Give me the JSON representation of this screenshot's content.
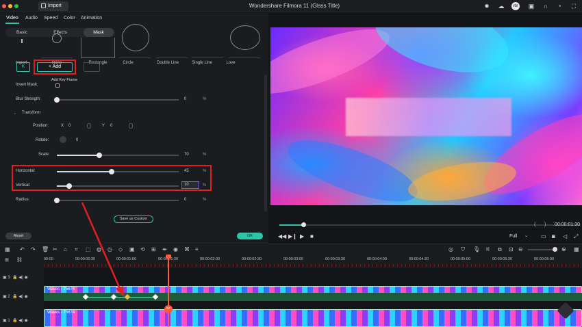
{
  "titlebar": {
    "import_label": "Import",
    "app_title": "Wondershare Filmora 11 (Glass Title)"
  },
  "panel": {
    "tabs": [
      "Video",
      "Audio",
      "Speed",
      "Color",
      "Animation"
    ],
    "subtabs": [
      "Basic",
      "Effects",
      "Mask"
    ],
    "shapes": [
      "Import",
      "None",
      "Rectangle",
      "Circle",
      "Double Line",
      "Single Line",
      "Love"
    ],
    "add_label": "Add",
    "add_tooltip": "Add Key Frame",
    "keyframe_prev": "K",
    "invert_mask": "Invert Mask:",
    "blur_strength": {
      "label": "Blur Strength:",
      "value": "0",
      "unit": "%",
      "fraction": 0.0
    },
    "transform": "Transform",
    "position": {
      "label": "Position:",
      "x_label": "X",
      "x": "0",
      "y_label": "Y",
      "y": "0"
    },
    "rotate": {
      "label": "Rotate:",
      "value": "0"
    },
    "scale": {
      "label": "Scale:",
      "value": "70",
      "unit": "%",
      "fraction": 0.35
    },
    "horizontal": {
      "label": "Horizontal:",
      "value": "45",
      "unit": "%",
      "fraction": 0.45
    },
    "vertical": {
      "label": "Vertical:",
      "value": "10",
      "unit": "%",
      "fraction": 0.1
    },
    "radius": {
      "label": "Radius:",
      "value": "0",
      "unit": "%",
      "fraction": 0.0
    },
    "save_custom": "Save as Custom",
    "reset": "Reset",
    "ok": "OK"
  },
  "player": {
    "timecode": "00:00:01:30",
    "quality": "Full",
    "progress_fraction": 0.08
  },
  "ruler": [
    "00:00",
    "00:00:00:30",
    "00:00:01:00",
    "00:00:01:30",
    "00:00:02:00",
    "00:00:02:30",
    "00:00:03:00",
    "00:00:03:30",
    "00:00:04:00",
    "00:00:04:30",
    "00:00:05:00",
    "00:00:05:30",
    "00:00:06:00"
  ],
  "tracks": [
    {
      "num": "3",
      "clip": ""
    },
    {
      "num": "2",
      "clip": "Waves - 75674"
    },
    {
      "num": "1",
      "clip": "Waves - 75674"
    }
  ],
  "colors": {
    "accent": "#2ec4a8",
    "highlight_red": "#e02020",
    "playhead": "#ff5a3c"
  }
}
